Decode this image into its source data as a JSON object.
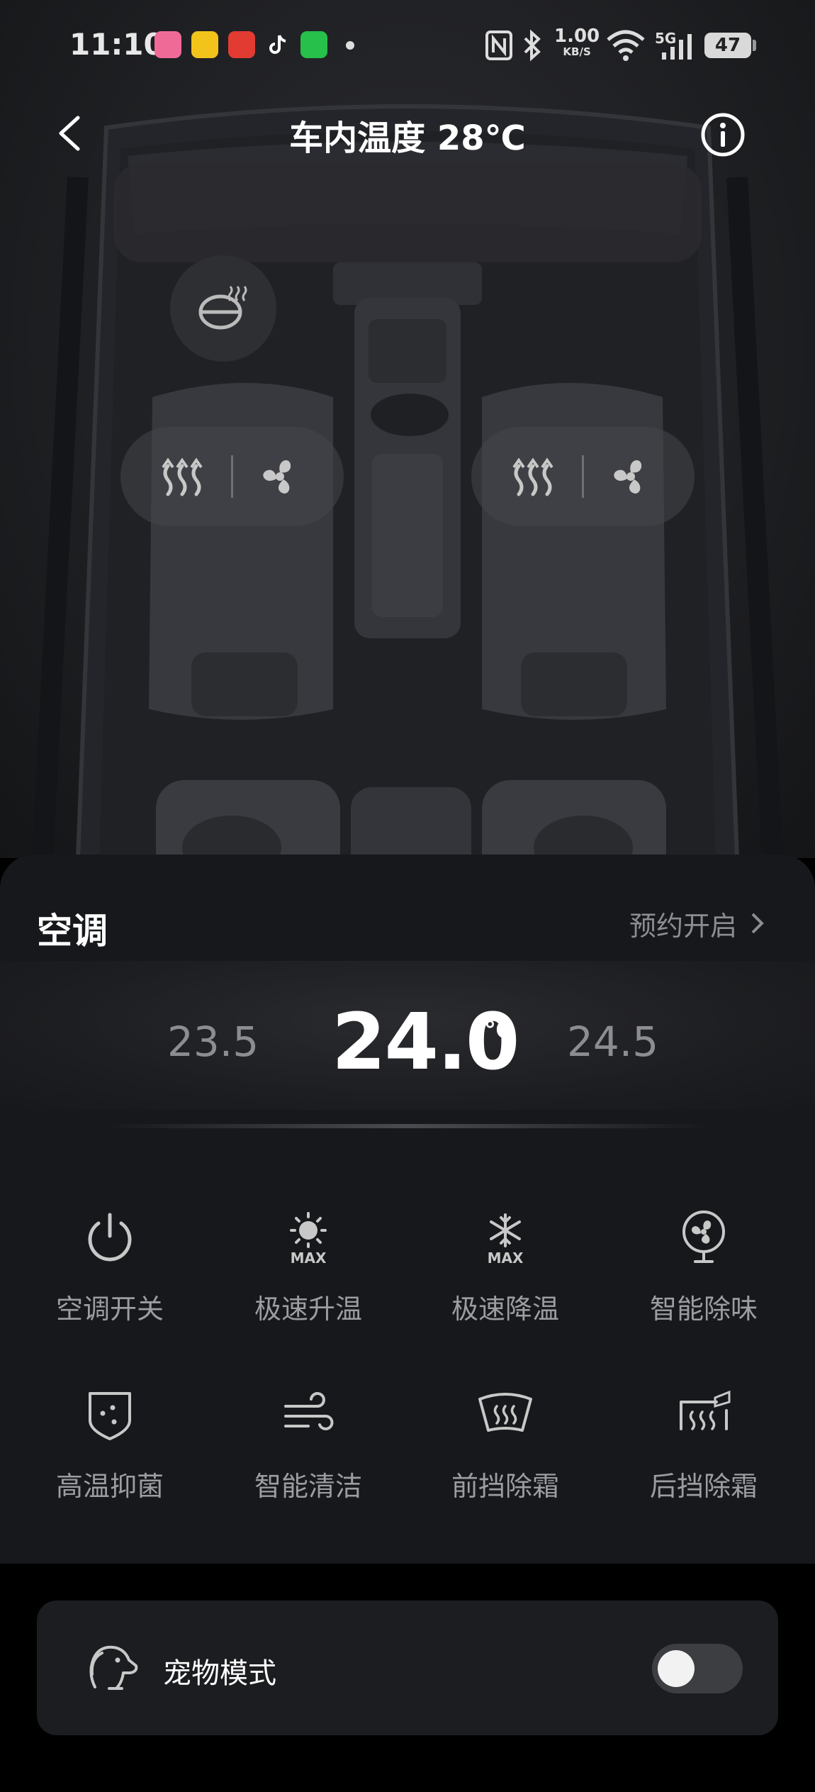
{
  "status_bar": {
    "time": "11:10",
    "net_speed_value": "1.00",
    "net_speed_unit": "KB/S",
    "network": "5G",
    "battery": "47",
    "apps": [
      "bilibili-icon",
      "yellow-app-icon",
      "red-app-icon",
      "tiktok-icon",
      "wechat-icon"
    ]
  },
  "header": {
    "title": "车内温度 28℃"
  },
  "seats": {
    "left": [
      "seat-heat-icon",
      "seat-fan-icon"
    ],
    "right": [
      "seat-heat-icon",
      "seat-fan-icon"
    ]
  },
  "ac_panel": {
    "title": "空调",
    "schedule_label": "预约开启",
    "temp_low": "23.5",
    "temp_current": "24.0",
    "temp_unit": "℃",
    "temp_high": "24.5",
    "buttons": [
      {
        "label": "空调开关",
        "icon": "power-icon"
      },
      {
        "label": "极速升温",
        "icon": "sun-max-icon"
      },
      {
        "label": "极速降温",
        "icon": "snowflake-max-icon"
      },
      {
        "label": "智能除味",
        "icon": "fan-icon"
      },
      {
        "label": "高温抑菌",
        "icon": "shield-dots-icon"
      },
      {
        "label": "智能清洁",
        "icon": "wind-icon"
      },
      {
        "label": "前挡除霜",
        "icon": "front-defrost-icon"
      },
      {
        "label": "后挡除霜",
        "icon": "rear-defrost-icon"
      }
    ],
    "icon_max_text": "MAX"
  },
  "pet_mode": {
    "label": "宠物模式",
    "enabled": false
  },
  "colors": {
    "background": "#000000",
    "panel": "#17181b",
    "card": "#1c1d20",
    "muted_text": "#8c8d91"
  }
}
